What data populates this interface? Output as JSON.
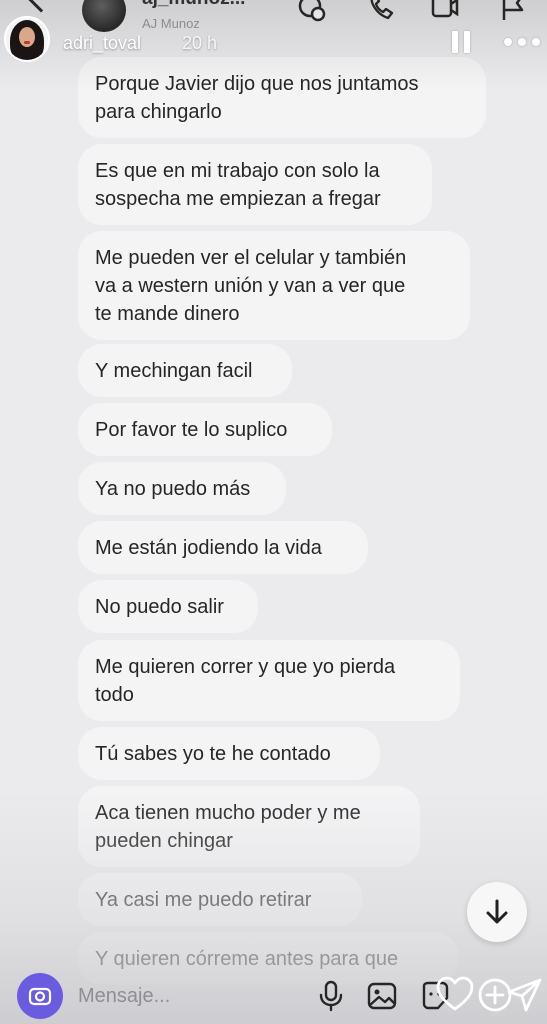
{
  "dm_header": {
    "username": "aj_munoz...",
    "subname": "AJ Munoz"
  },
  "story": {
    "username": "adri_toval",
    "time": "20 h"
  },
  "messages": [
    {
      "text": "Porque Javier dijo que nos juntamos\npara chingarlo"
    },
    {
      "text": "Es que en mi trabajo con solo la\nsospecha me empiezan a fregar"
    },
    {
      "text": "Me pueden ver el celular y también\nva a western unión y van a ver que\nte mande dinero"
    },
    {
      "text": "Y mechingan facil"
    },
    {
      "text": "Por favor te lo suplico"
    },
    {
      "text": "Ya no puedo más"
    },
    {
      "text": "Me están jodiendo la vida"
    },
    {
      "text": "No puedo salir"
    },
    {
      "text": "Me quieren correr y que yo pierda\ntodo"
    },
    {
      "text": "Tú sabes yo te he contado"
    },
    {
      "text": "Aca tienen mucho poder y me\npueden chingar"
    },
    {
      "text": "Ya casi me puedo retirar"
    },
    {
      "text": "Y quieren córreme antes para que"
    }
  ],
  "composer": {
    "placeholder": "Mensaje..."
  },
  "icons": {
    "back": "chevron-left-icon",
    "video_call": "video-camera-icon",
    "phone": "phone-icon",
    "flag": "flag-icon",
    "pause": "pause-icon",
    "more": "more-dots-icon",
    "scroll_down": "arrow-down-icon",
    "camera": "camera-icon",
    "mic": "microphone-icon",
    "gallery": "image-icon",
    "sticker": "sticker-icon",
    "like": "heart-icon",
    "add": "plus-circle-icon",
    "send": "send-icon"
  },
  "colors": {
    "camera_button": "#6a5ce0",
    "bubble": "#f4f4f5",
    "background": "#ebebed"
  }
}
